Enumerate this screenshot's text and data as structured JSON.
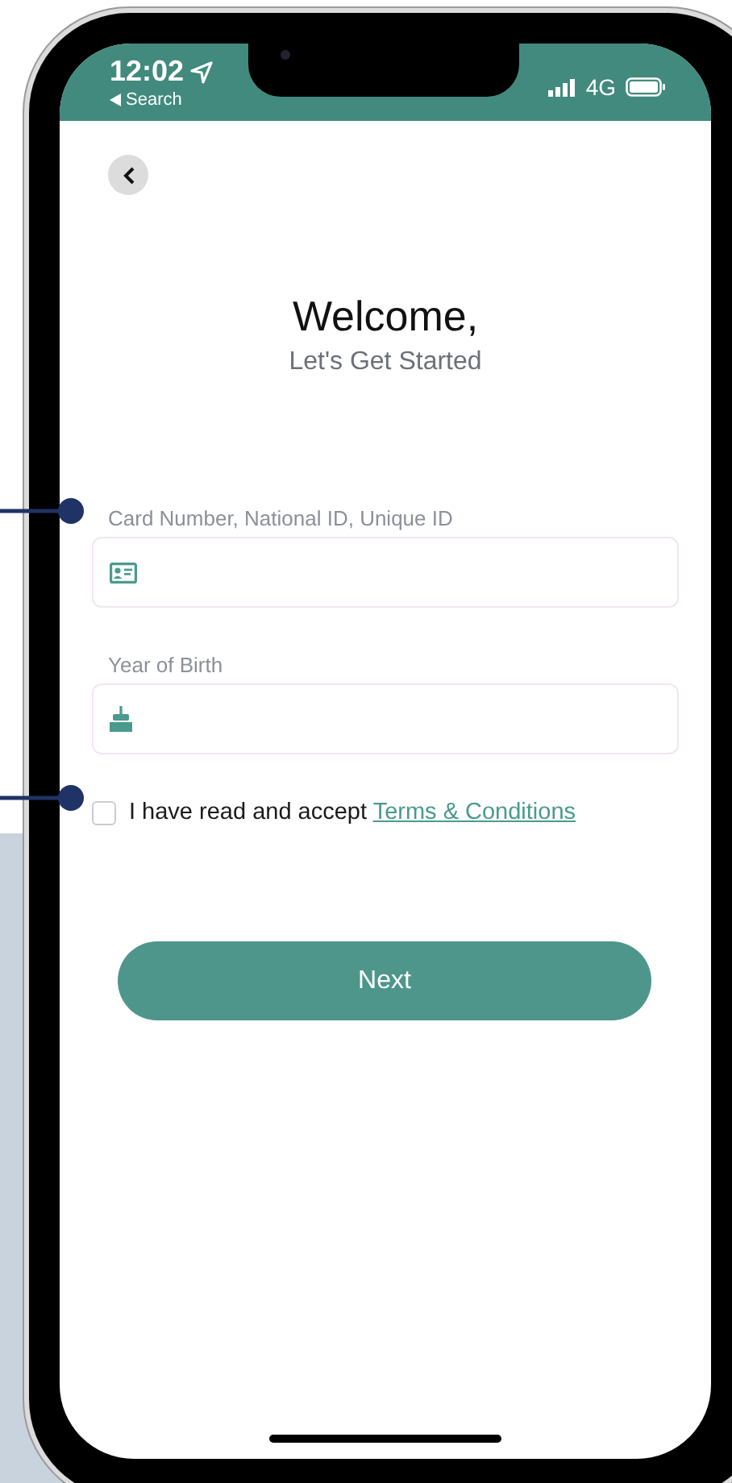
{
  "status_bar": {
    "time": "12:02",
    "back_link": "Search",
    "network": "4G"
  },
  "header": {
    "title": "Welcome,",
    "subtitle": "Let's Get Started"
  },
  "fields": [
    {
      "label": "Card Number, National ID, Unique ID",
      "kind": "id-card"
    },
    {
      "label": "Year of Birth",
      "kind": "cake"
    }
  ],
  "terms": {
    "text": "I have read and accept",
    "link": "Terms & Conditions",
    "checked": false
  },
  "button": {
    "label": "Next"
  }
}
